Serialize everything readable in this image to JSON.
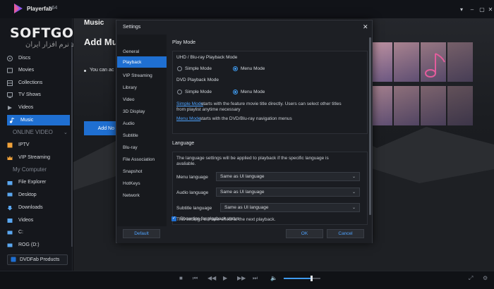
{
  "app": {
    "name": "Playerfab",
    "version": "x64",
    "watermark": "SOFTGOZAR.COM",
    "watermark_sub": "اولین وب سایت دانلود نرم افزار ایران"
  },
  "sidebar": {
    "items": [
      {
        "label": "Discs"
      },
      {
        "label": "Movies"
      },
      {
        "label": "Collections"
      },
      {
        "label": "TV Shows"
      },
      {
        "label": "Videos"
      },
      {
        "label": "Music"
      }
    ],
    "online_section": "ONLINE VIDEO",
    "online_items": [
      {
        "label": "IPTV"
      },
      {
        "label": "VIP Streaming"
      }
    ],
    "computer_section": "My Computer",
    "computer_items": [
      {
        "label": "File Explorer"
      },
      {
        "label": "Desktop"
      },
      {
        "label": "Downloads"
      },
      {
        "label": "Videos"
      },
      {
        "label": "C:"
      },
      {
        "label": "ROG (D:)"
      }
    ],
    "products_button": "DVDFab Products"
  },
  "main": {
    "title": "Music",
    "subtitle": "Add Mu",
    "bullet_text": "You can ac",
    "add_button": "Add No"
  },
  "dialog": {
    "title": "Settings",
    "nav": [
      "General",
      "Playback",
      "VIP Streaming",
      "Library",
      "Video",
      "3D Display",
      "Audio",
      "Subtitle",
      "Blu-ray",
      "File Association",
      "Snapshot",
      "HotKeys",
      "Network"
    ],
    "active_nav": "Playback",
    "play_mode": {
      "heading": "Play Mode",
      "uhd_label": "UHD / Blu-ray Playback Mode",
      "dvd_label": "DVD Playback Mode",
      "simple": "Simple Mode",
      "menu": "Menu Mode",
      "uhd_selected": "Menu Mode",
      "dvd_selected": "Menu Mode",
      "simple_link": "Simple Mode",
      "simple_desc": " starts with the feature movie title directly. Users can select other titles",
      "simple_desc2": "from playlist anytime necessary",
      "menu_link": "Menu Mode",
      "menu_desc": " starts with the DVD/Blu-ray navigation menus"
    },
    "language": {
      "heading": "Language",
      "note1": "The language settings will be applied to playback if the specific language is",
      "note2": "avaliable.",
      "menu_label": "Menu language",
      "menu_value": "Same as UI language",
      "audio_label": "Audio language",
      "audio_value": "Same as UI language",
      "subtitle_label": "Subtitle language",
      "subtitle_value": "Same as UI language",
      "footnote": "This settings will take effect at the next playback."
    },
    "show_tips": "Show tips for playback status",
    "show_tips_checked": true,
    "default_button": "Default",
    "ok_button": "OK",
    "cancel_button": "Cancel"
  },
  "player": {
    "volume": 0.75
  },
  "colors": {
    "accent": "#1f6fd1",
    "link": "#4ea3ff"
  }
}
